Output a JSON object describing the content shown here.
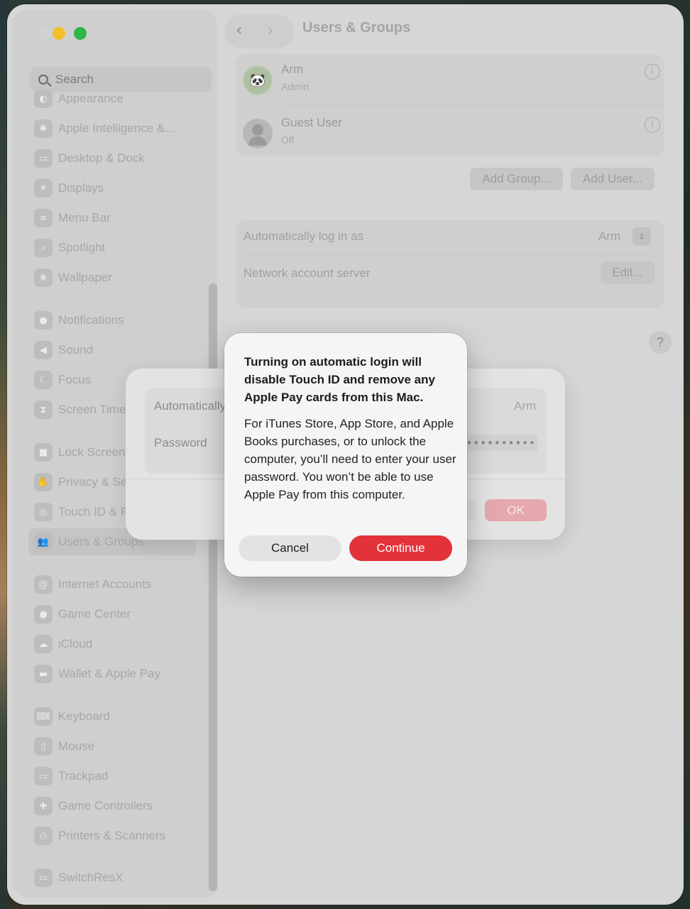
{
  "window": {
    "title": "Users & Groups"
  },
  "sidebar": {
    "search_placeholder": "Search",
    "items": [
      {
        "label": "Appearance",
        "icon": "appearance-icon",
        "glyph": "◐"
      },
      {
        "label": "Apple Intelligence &...",
        "icon": "apple-intelligence-icon",
        "glyph": "✺"
      },
      {
        "label": "Desktop & Dock",
        "icon": "desktop-dock-icon",
        "glyph": "▭"
      },
      {
        "label": "Displays",
        "icon": "displays-icon",
        "glyph": "☀"
      },
      {
        "label": "Menu Bar",
        "icon": "menu-bar-icon",
        "glyph": "≡"
      },
      {
        "label": "Spotlight",
        "icon": "spotlight-icon",
        "glyph": "⌕"
      },
      {
        "label": "Wallpaper",
        "icon": "wallpaper-icon",
        "glyph": "❀"
      },
      {
        "label": "Notifications",
        "icon": "notifications-icon",
        "glyph": "●"
      },
      {
        "label": "Sound",
        "icon": "sound-icon",
        "glyph": "◀"
      },
      {
        "label": "Focus",
        "icon": "focus-icon",
        "glyph": "☾"
      },
      {
        "label": "Screen Time",
        "icon": "screen-time-icon",
        "glyph": "⧗"
      },
      {
        "label": "Lock Screen",
        "icon": "lock-screen-icon",
        "glyph": "■"
      },
      {
        "label": "Privacy & Security",
        "icon": "privacy-security-icon",
        "glyph": "✋"
      },
      {
        "label": "Touch ID & Password",
        "icon": "touch-id-icon",
        "glyph": "◎"
      },
      {
        "label": "Users & Groups",
        "icon": "users-groups-icon",
        "glyph": "👥"
      },
      {
        "label": "Internet Accounts",
        "icon": "internet-accounts-icon",
        "glyph": "@"
      },
      {
        "label": "Game Center",
        "icon": "game-center-icon",
        "glyph": "●"
      },
      {
        "label": "iCloud",
        "icon": "icloud-icon",
        "glyph": "☁"
      },
      {
        "label": "Wallet & Apple Pay",
        "icon": "wallet-icon",
        "glyph": "▬"
      },
      {
        "label": "Keyboard",
        "icon": "keyboard-icon",
        "glyph": "⌨"
      },
      {
        "label": "Mouse",
        "icon": "mouse-icon",
        "glyph": "▯"
      },
      {
        "label": "Trackpad",
        "icon": "trackpad-icon",
        "glyph": "▭"
      },
      {
        "label": "Game Controllers",
        "icon": "game-controllers-icon",
        "glyph": "✚"
      },
      {
        "label": "Printers & Scanners",
        "icon": "printers-scanners-icon",
        "glyph": "⎙"
      },
      {
        "label": "SwitchResX",
        "icon": "switchresx-icon",
        "glyph": "▭"
      }
    ]
  },
  "users": [
    {
      "name": "Arm",
      "role": "Admin",
      "avatar": "panda-avatar-icon"
    },
    {
      "name": "Guest User",
      "role": "Off",
      "avatar": "guest-avatar-icon"
    }
  ],
  "actions": {
    "add_group": "Add Group...",
    "add_user": "Add User..."
  },
  "settings": {
    "auto_login_label": "Automatically log in as",
    "auto_login_value": "Arm",
    "network_server_label": "Network account server",
    "network_server_button": "Edit..."
  },
  "help_label": "?",
  "sheet": {
    "auto_login_label": "Automatically log in as",
    "auto_login_value": "Arm",
    "password_label": "Password",
    "password_value": "••••••••••",
    "ok_label": "OK"
  },
  "alert": {
    "title": "Turning on automatic login will disable Touch ID and remove any Apple Pay cards from this Mac.",
    "body": "For iTunes Store, App Store, and Apple Books purchases, or to unlock the computer, you’ll need to enter your user password. You won’t be able to use Apple Pay from this computer.",
    "cancel_label": "Cancel",
    "continue_label": "Continue"
  },
  "colors": {
    "accent_destructive": "#e2333b",
    "traffic_yellow": "#f3be2e",
    "traffic_green": "#2fb54a"
  }
}
